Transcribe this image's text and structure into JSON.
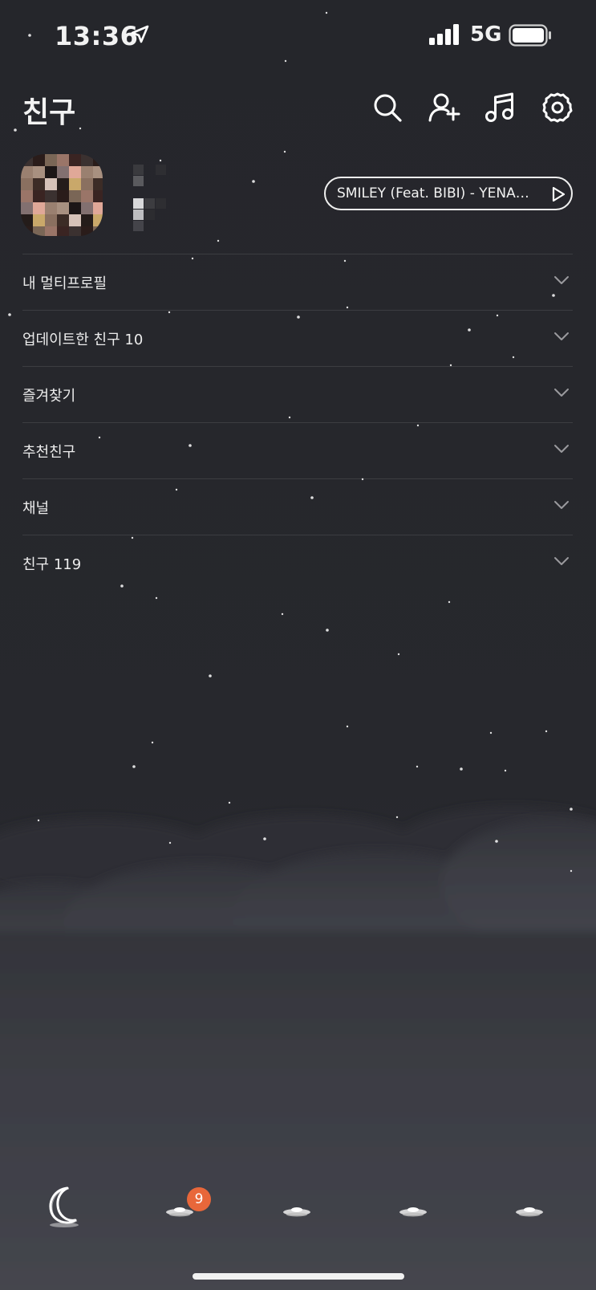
{
  "status_bar": {
    "time": "13:36",
    "network": "5G"
  },
  "header": {
    "title": "친구",
    "icons": [
      "search-icon",
      "add-friend-icon",
      "music-icon",
      "settings-icon"
    ]
  },
  "profile": {
    "music": {
      "text": "SMILEY (Feat. BIBI) - YENA…"
    }
  },
  "sections": [
    {
      "label": "내 멀티프로필"
    },
    {
      "label": "업데이트한 친구 10"
    },
    {
      "label": "즐겨찾기"
    },
    {
      "label": "추천친구"
    },
    {
      "label": "채널"
    },
    {
      "label": "친구 119"
    }
  ],
  "tab_bar": {
    "tabs": [
      "moon-icon",
      "cloud-icon",
      "cloud-icon",
      "cloud-icon",
      "cloud-icon"
    ],
    "badge": "9"
  },
  "colors": {
    "background": "#26272c",
    "badge": "#e8673a",
    "text": "#f2f2f2"
  }
}
